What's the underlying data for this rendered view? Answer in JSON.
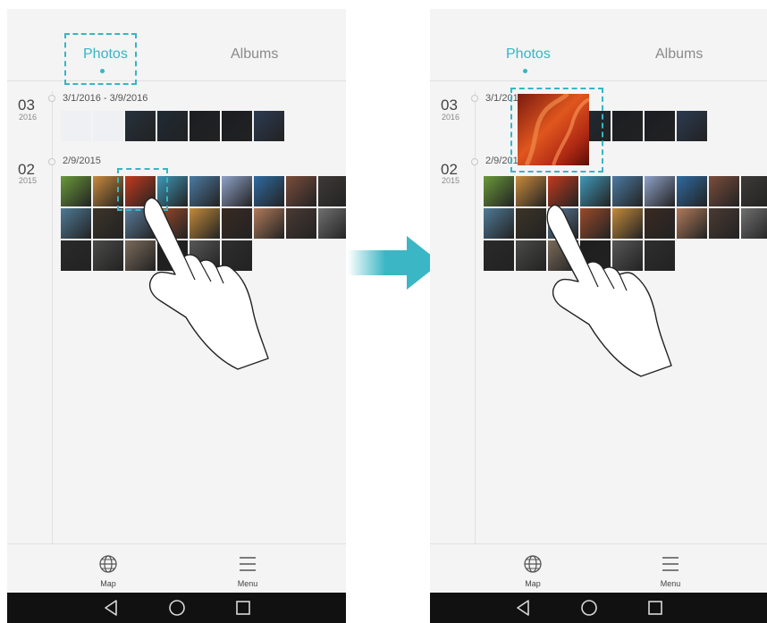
{
  "left_screen": {
    "tabs": [
      {
        "label": "Photos",
        "active": true
      },
      {
        "label": "Albums",
        "active": false
      }
    ],
    "groups": [
      {
        "month": "03",
        "year": "2016",
        "date_range": "3/1/2016 - 3/9/2016"
      },
      {
        "month": "02",
        "year": "2015",
        "date_range": "2/9/2015"
      }
    ],
    "bottom_nav": [
      {
        "label": "Map",
        "icon": "globe-icon"
      },
      {
        "label": "Menu",
        "icon": "menu-icon"
      }
    ]
  },
  "right_screen": {
    "tabs": [
      {
        "label": "Photos",
        "active": true
      },
      {
        "label": "Albums",
        "active": false
      }
    ],
    "groups": [
      {
        "month": "03",
        "year": "2016",
        "date_range": "3/1/201"
      },
      {
        "month": "02",
        "year": "2015",
        "date_range": "2/9/201"
      }
    ],
    "bottom_nav": [
      {
        "label": "Map",
        "icon": "globe-icon"
      },
      {
        "label": "Menu",
        "icon": "menu-icon"
      }
    ]
  },
  "system_nav": [
    "back-icon",
    "home-icon",
    "recents-icon"
  ],
  "colors": {
    "accent": "#35b7c3",
    "arrow": "#3bb6c4",
    "navbar": "#111111",
    "background": "#f4f4f4"
  },
  "group_2016_thumbs": [
    "#e8eaef",
    "#e6e8ee",
    "#26323d",
    "#1f2a35",
    "#1b1e22",
    "#1a1d22",
    "#2c3b52"
  ],
  "group_2015_thumbs": [
    "#6a9a3a",
    "#c98a3c",
    "#c23a1e",
    "#3f98b8",
    "#4c7aa2",
    "#8fa2c8",
    "#2f6aa0",
    "#7a4d3c",
    "#3d3a38",
    "#4f7a96",
    "#3c3428",
    "#5a7a9a",
    "#9a4a2a",
    "#c28a3a",
    "#3a2a22",
    "#b07a5a",
    "#4a3a33",
    "#6f6f6f",
    "#2a2a2a",
    "#4a4a48",
    "#7a6a5a",
    "#1e1e1e",
    "#575757",
    "#2e2e2e"
  ]
}
